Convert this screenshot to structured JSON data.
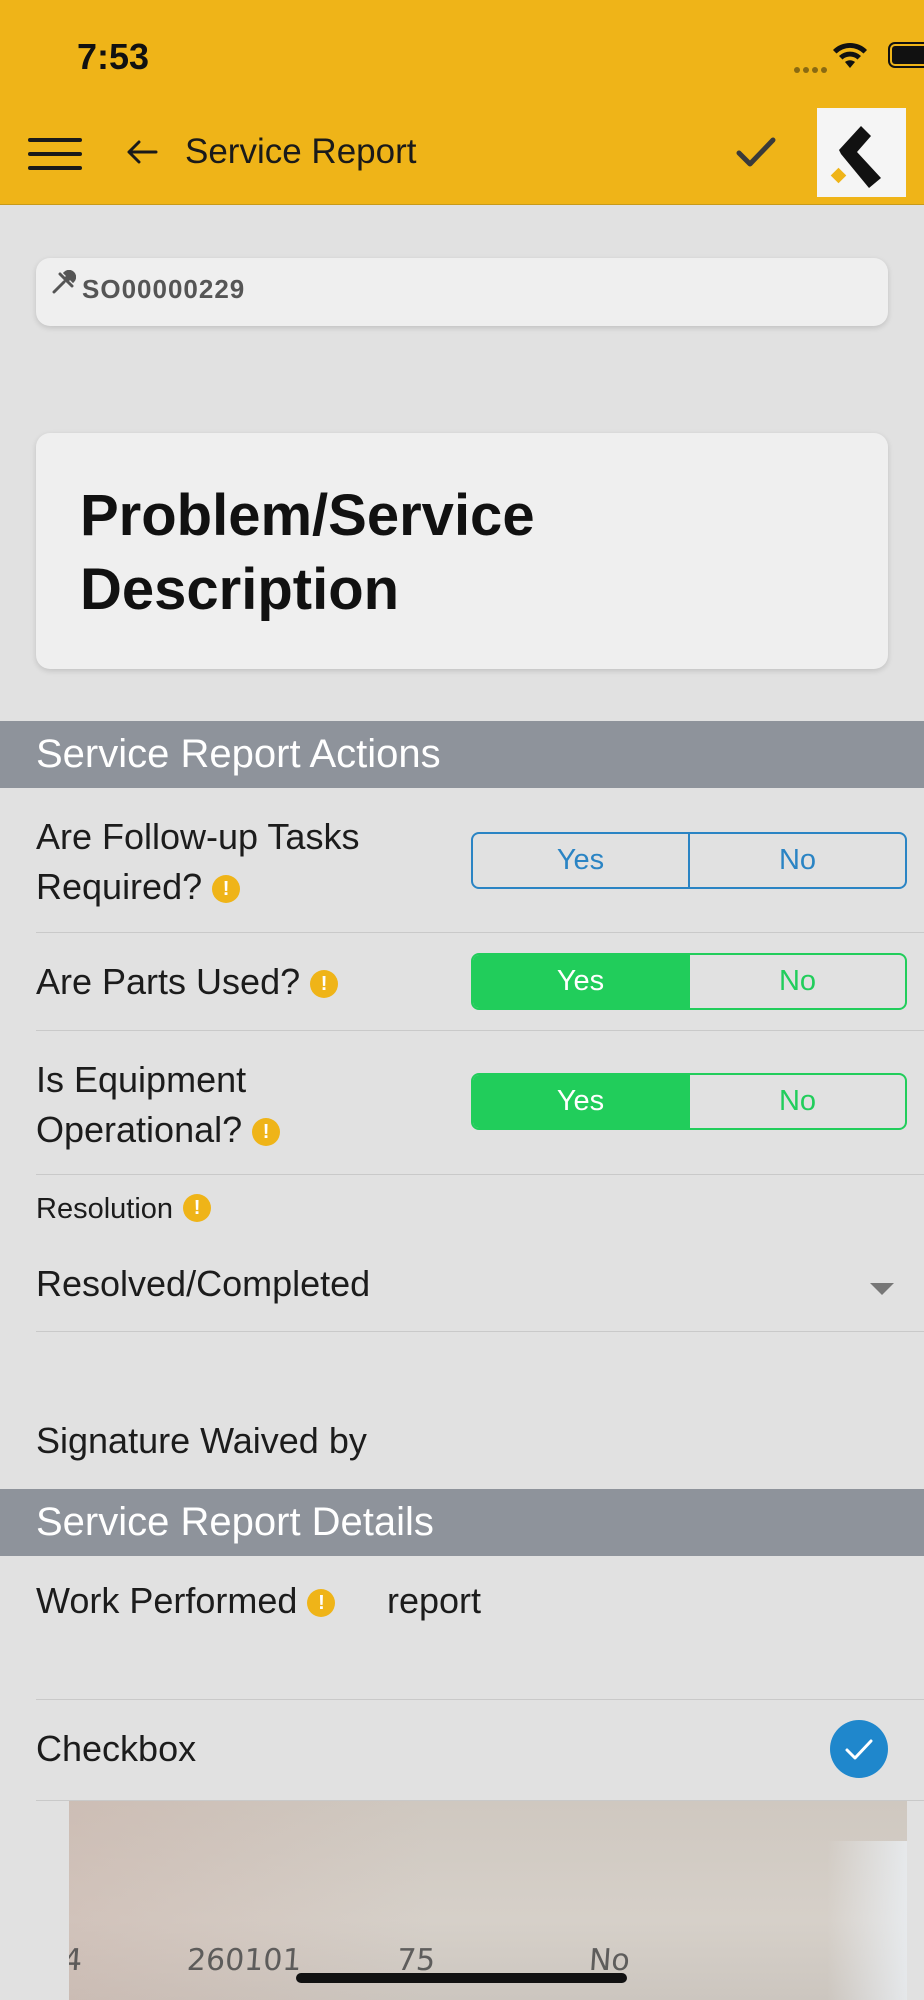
{
  "status_bar": {
    "time": "7:53"
  },
  "nav": {
    "title": "Service Report"
  },
  "order": {
    "id": "SO00000229"
  },
  "card": {
    "title": "Problem/Service Description"
  },
  "sections": {
    "actions_title": "Service Report Actions",
    "details_title": "Service Report Details"
  },
  "questions": [
    {
      "label": "Are Follow-up Tasks Required?",
      "yes": "Yes",
      "no": "No",
      "selected": null
    },
    {
      "label": "Are Parts Used?",
      "yes": "Yes",
      "no": "No",
      "selected": "Yes"
    },
    {
      "label": "Is Equipment Operational?",
      "yes": "Yes",
      "no": "No",
      "selected": "Yes"
    }
  ],
  "resolution": {
    "label": "Resolution",
    "value": "Resolved/Completed"
  },
  "signature": {
    "label": "Signature Waived by"
  },
  "work_performed": {
    "label": "Work Performed",
    "value": "report"
  },
  "checkbox": {
    "label": "Checkbox",
    "checked": true
  },
  "photo": {
    "cells": [
      "260101",
      "75",
      "No"
    ]
  },
  "colors": {
    "brand_yellow": "#efb418",
    "section_gray": "#8e939b",
    "selected_green": "#21cd5b",
    "segment_blue": "#2a84c4",
    "check_blue": "#1f87cc"
  }
}
